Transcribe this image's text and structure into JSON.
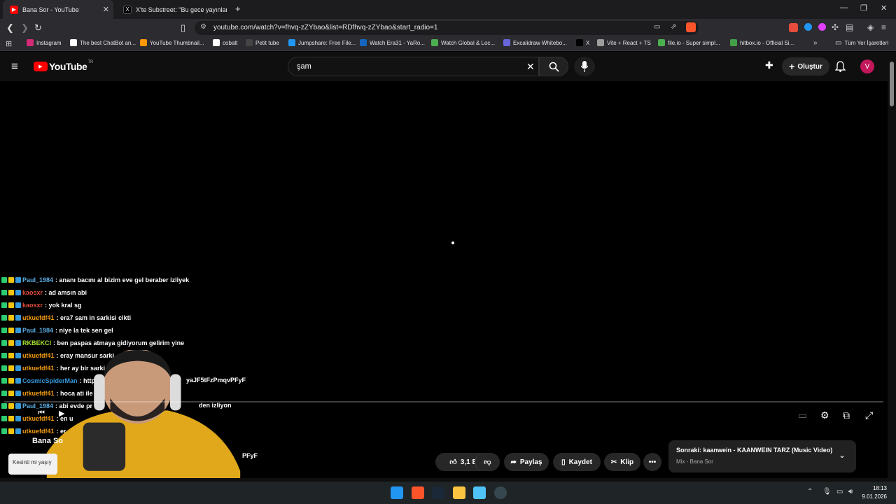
{
  "browser": {
    "tabs": [
      {
        "label": "Bana Sor - YouTube",
        "active": true
      },
      {
        "label": "X'te Substreet: \"Bu gece yayınlanacak",
        "active": false
      }
    ],
    "new_tab": "+",
    "url": "youtube.com/watch?v=fhvq-zZYbao&list=RDfhvq-zZYbao&start_radio=1",
    "bookmarks": [
      {
        "label": "Instagram",
        "color": "#d62976"
      },
      {
        "label": "The best ChatBot an...",
        "color": "#ffffff"
      },
      {
        "label": "YouTube Thumbnail...",
        "color": "#ff9800"
      },
      {
        "label": "cobalt",
        "color": "#ffffff"
      },
      {
        "label": "Petit tube",
        "color": "#444444"
      },
      {
        "label": "Jumpshare: Free File...",
        "color": "#2196f3"
      },
      {
        "label": "Watch Era31 - YaRo...",
        "color": "#1565c0"
      },
      {
        "label": "Watch Global & Loc...",
        "color": "#4caf50"
      },
      {
        "label": "Excalidraw Whitebo...",
        "color": "#6965db"
      },
      {
        "label": "X",
        "color": "#000000"
      },
      {
        "label": "Vite + React + TS",
        "color": "#9e9e9e"
      },
      {
        "label": "file.io - Super simpl...",
        "color": "#4caf50"
      },
      {
        "label": "hitbox.io - Official Si...",
        "color": "#43a047"
      }
    ],
    "all_bookmarks": "Tüm Yer İşaretleri"
  },
  "youtube": {
    "logo_text": "YouTube",
    "region": "TR",
    "search_value": "şam",
    "create_label": "Oluştur",
    "avatar_letter": "V",
    "chat": [
      {
        "user": "Paul_1984",
        "msg": ": ananı bacını al bizim eve gel beraber izliyek",
        "color": "#5dade2"
      },
      {
        "user": "kaosxr",
        "msg": ": ad amsın abi",
        "color": "#e74c3c"
      },
      {
        "user": "kaosxr",
        "msg": ": yok kral sg",
        "color": "#e74c3c"
      },
      {
        "user": "utkuefdf41",
        "msg": ": era7 sam in sarkisi cikti",
        "color": "#f39c12"
      },
      {
        "user": "Paul_1984",
        "msg": ": niye la tek sen gel",
        "color": "#5dade2"
      },
      {
        "user": "RKBEKCI",
        "msg": ": ben paspas atmaya gidiyorum gelirim yine",
        "color": "#a6e22e"
      },
      {
        "user": "utkuefdf41",
        "msg": ": eray mansur sarki",
        "color": "#f39c12"
      },
      {
        "user": "utkuefdf41",
        "msg": ": her ay bir sarki",
        "color": "#f39c12"
      },
      {
        "user": "CosmicSpiderMan",
        "msg": ": http",
        "color": "#3498db"
      },
      {
        "user": "utkuefdf41",
        "msg": ": hoca ati ile l",
        "color": "#f39c12"
      },
      {
        "user": "Paul_1984",
        "msg": ": abi evde pr",
        "color": "#5dade2"
      },
      {
        "user": "utkuefdf41",
        "msg": ": en u",
        "color": "#f39c12"
      },
      {
        "user": "utkuefdf41",
        "msg": ": er",
        "color": "#f39c12"
      }
    ],
    "chat_fragment_1": "yaJF5tFzPmqvPFyF",
    "chat_fragment_2": "den izliyon",
    "chat_fragment_3": "PFyF",
    "overlay_title": "Bana So",
    "overlay_sub": "Kesinti mi yaşıy",
    "like_count": "3,1 B",
    "share_label": "Paylaş",
    "save_label": "Kaydet",
    "clip_label": "Klip",
    "up_next_title": "Sonraki: kaanwein - KAANWEIN TARZ (Music Video)",
    "up_next_sub": "Mix - Bana Sor"
  },
  "taskbar": {
    "time": "18:13",
    "date": "9.01.2026"
  }
}
